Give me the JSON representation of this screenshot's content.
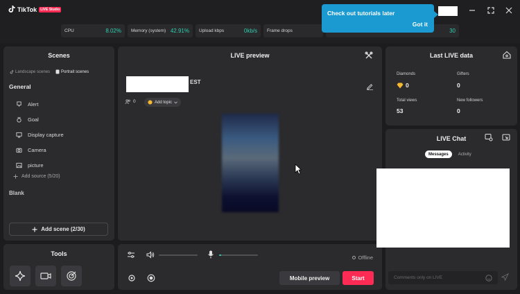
{
  "app": {
    "name": "TikTok",
    "badge": "LIVE Studio"
  },
  "stats": {
    "cpu": {
      "label": "CPU",
      "value": "8.02%"
    },
    "memory": {
      "label": "Memory (system)",
      "value": "42.91%"
    },
    "upload": {
      "label": "Upload kbps",
      "value": "0kb/s"
    },
    "frames": {
      "label": "Frame drops",
      "value": ""
    },
    "extra": {
      "value": "30"
    }
  },
  "tooltip": {
    "message": "Check out tutorials later",
    "button": "Got it"
  },
  "scenes": {
    "title": "Scenes",
    "tabs": [
      {
        "label": "Landscape scenes",
        "active": false
      },
      {
        "label": "Portrait scenes",
        "active": true
      }
    ],
    "group_general": "General",
    "sources": [
      {
        "label": "Alert",
        "icon": "alert-icon"
      },
      {
        "label": "Goal",
        "icon": "goal-icon"
      },
      {
        "label": "Display capture",
        "icon": "monitor-icon"
      },
      {
        "label": "Camera",
        "icon": "camera-icon"
      },
      {
        "label": "picture",
        "icon": "image-icon"
      }
    ],
    "add_source": "Add source (5/20)",
    "group_blank": "Blank",
    "add_scene": "Add scene (2/30)"
  },
  "tools": {
    "title": "Tools",
    "items": [
      "sparkle-icon",
      "video-camera-icon",
      "target-icon"
    ]
  },
  "preview": {
    "title": "LIVE preview",
    "stream_title_suffix": "EST",
    "viewers": "0",
    "add_topic": "Add topic"
  },
  "controls": {
    "status": "Offline",
    "mobile_preview": "Mobile preview",
    "start": "Start",
    "volume_level": 0,
    "mic_level": 0.03
  },
  "last_live": {
    "title": "Last LIVE data",
    "diamonds": {
      "label": "Diamonds",
      "value": "0"
    },
    "gifters": {
      "label": "Gifters",
      "value": "0"
    },
    "total_views": {
      "label": "Total views",
      "value": "53"
    },
    "new_followers": {
      "label": "New followers",
      "value": "0"
    }
  },
  "chat": {
    "title": "LIVE Chat",
    "tabs": [
      {
        "label": "Messages",
        "active": true
      },
      {
        "label": "Activity",
        "active": false
      }
    ],
    "input_placeholder": "Comments only on LIVE"
  },
  "colors": {
    "accent": "#fe2c55",
    "teal": "#2ecfb0",
    "tooltip": "#1a9ad0",
    "panel": "#2b2b2e",
    "background": "#1c1c1e"
  }
}
